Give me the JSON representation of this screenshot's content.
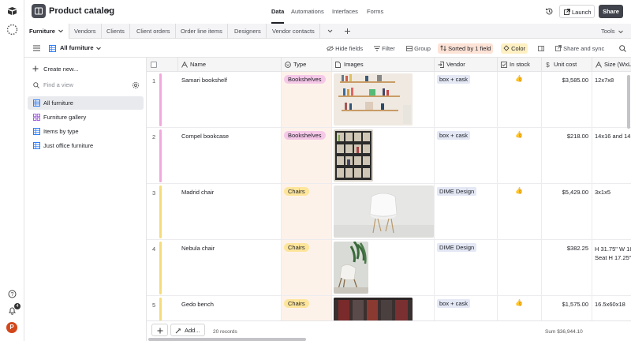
{
  "app": {
    "base_title": "Product catalog",
    "nav": [
      "Data",
      "Automations",
      "Interfaces",
      "Forms"
    ],
    "nav_active": "Data",
    "launch_label": "Launch",
    "share_label": "Share",
    "avatar_initial": "P",
    "notification_count": "4"
  },
  "tables": {
    "items": [
      "Furniture",
      "Vendors",
      "Clients",
      "Client orders",
      "Order line items",
      "Designers",
      "Vendor contacts"
    ],
    "active": "Furniture",
    "tools_label": "Tools"
  },
  "view": {
    "name": "All furniture",
    "hide_fields": "Hide fields",
    "filter": "Filter",
    "group": "Group",
    "sort": "Sorted by 1 field",
    "color": "Color",
    "share_sync": "Share and sync"
  },
  "sidebar": {
    "create_new": "Create new...",
    "find_placeholder": "Find a view",
    "views": [
      {
        "label": "All furniture",
        "icon": "grid-view-icon"
      },
      {
        "label": "Furniture gallery",
        "icon": "gallery-view-icon"
      },
      {
        "label": "Items by type",
        "icon": "grid-view-icon"
      },
      {
        "label": "Just office furniture",
        "icon": "grid-view-icon"
      }
    ]
  },
  "grid": {
    "columns": [
      "Name",
      "Type",
      "Images",
      "Vendor",
      "In stock",
      "Unit cost",
      "Size (WxL"
    ],
    "rows": [
      {
        "num": "1",
        "name": "Samari bookshelf",
        "type": "Bookshelves",
        "vendor": "box + cask",
        "in_stock": "👍",
        "unit_cost": "$3,585.00",
        "size": "12x7x8"
      },
      {
        "num": "2",
        "name": "Compel bookcase",
        "type": "Bookshelves",
        "vendor": "box + cask",
        "in_stock": "👍",
        "unit_cost": "$218.00",
        "size": "14x16 and 14"
      },
      {
        "num": "3",
        "name": "Madrid chair",
        "type": "Chairs",
        "vendor": "DIME Design",
        "in_stock": "👍",
        "unit_cost": "$5,429.00",
        "size": "3x1x5"
      },
      {
        "num": "4",
        "name": "Nebula chair",
        "type": "Chairs",
        "vendor": "DIME Design",
        "in_stock": "",
        "unit_cost": "$382.25",
        "size": "H 31.75\" W 18",
        "size2": "Seat H 17.25\""
      },
      {
        "num": "5",
        "name": "Gedo bench",
        "type": "Chairs",
        "vendor": "box + cask",
        "in_stock": "👍",
        "unit_cost": "$1,575.00",
        "size": "16.5x60x18"
      }
    ],
    "records_count": "20 records",
    "sum_label": "Sum",
    "sum_value": "$36,944.10",
    "add_label": "Add..."
  },
  "colors": {
    "bookshelves_pill": "#f6c8e8",
    "chairs_pill": "#fde59b",
    "sorted_bg": "#fde2d6",
    "color_bg": "#fff0c2",
    "type_column_bg": "#fdf2ea"
  }
}
